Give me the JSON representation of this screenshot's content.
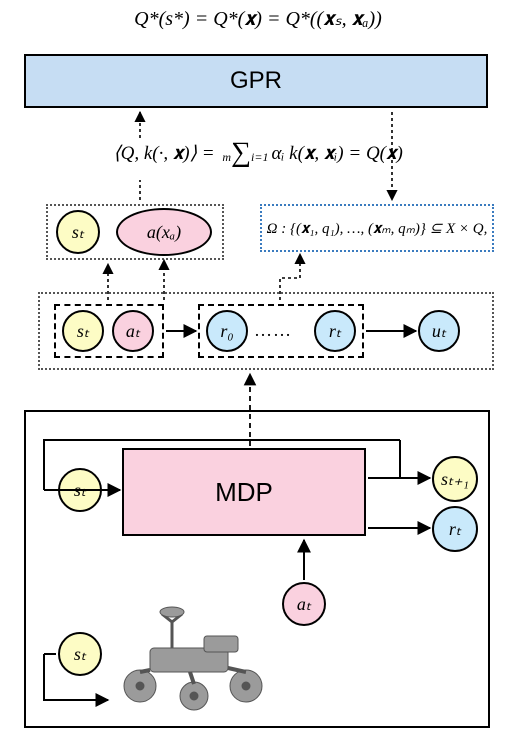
{
  "topEquation": "Q*(s*) = Q*(𝐱) = Q*((𝐱ₛ, 𝐱ₐ))",
  "gprLabel": "GPR",
  "midEq": {
    "lhs": "⟨Q, k(·, 𝐱)⟩ = ",
    "sumTop": "m",
    "sumBot": "i=1",
    "rhs": "αᵢ k(𝐱, 𝐱ᵢ) = Q(𝐱)"
  },
  "omega": "Ω : {(𝐱₁, q₁), …, (𝐱ₘ, qₘ)} ⊆ X × Q,",
  "nodes": {
    "s_t": "sₜ",
    "a_xa": "a(xₐ)",
    "a_t": "aₜ",
    "r_0": "r₀",
    "r_t": "rₜ",
    "u_t": "uₜ",
    "s_tp1": "sₜ₊₁",
    "dots": "……"
  },
  "mdpLabel": "MDP"
}
